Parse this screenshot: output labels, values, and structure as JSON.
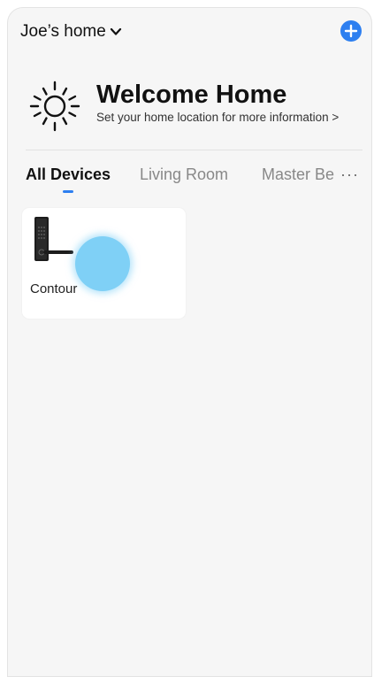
{
  "header": {
    "home_name": "Joe’s home",
    "chevron_icon": "chevron-down-icon",
    "add_icon": "plus-circle-icon"
  },
  "welcome": {
    "icon": "sun-icon",
    "title": "Welcome Home",
    "subtitle": "Set your home location for more information >"
  },
  "tabs": {
    "items": [
      {
        "label": "All Devices",
        "active": true
      },
      {
        "label": "Living Room",
        "active": false
      },
      {
        "label": "Master Be",
        "active": false
      }
    ],
    "more_label": "···"
  },
  "devices": [
    {
      "name": "Contour",
      "icon": "smart-lock-icon"
    }
  ],
  "colors": {
    "accent": "#2d7ff0",
    "background": "#f6f6f6",
    "touch_indicator": "#7fd0f6"
  }
}
